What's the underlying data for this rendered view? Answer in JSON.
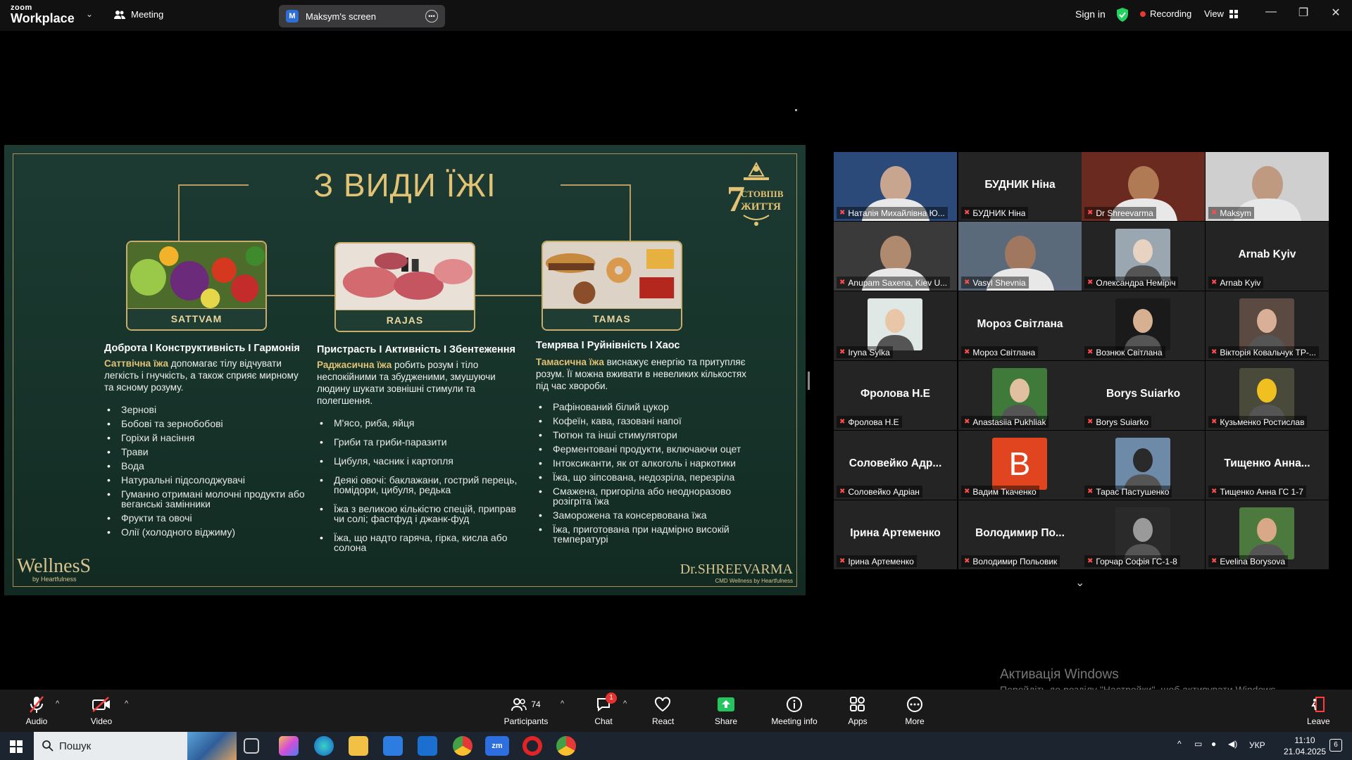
{
  "topbar": {
    "logo_top": "zoom",
    "logo_bottom": "Workplace",
    "meeting_label": "Meeting",
    "screen_avatar": "M",
    "screen_label": "Maksym's screen",
    "sign_in": "Sign in",
    "recording": "Recording",
    "view": "View"
  },
  "slide": {
    "title": "З ВИДИ ЇЖІ",
    "logo_line1": "СТОВПІВ",
    "logo_line2": "ЖИТТЯ",
    "logo_number": "7",
    "cards": [
      "SATTVAM",
      "RAJAS",
      "TAMAS"
    ],
    "columns": [
      {
        "heading": "Доброта I Конструктивність I Гармонія",
        "keyword": "Саттвічна їжа",
        "description": " допомагає тілу відчувати легкість і гнучкість, а також сприяє мирному та ясному розуму.",
        "items": [
          "Зернові",
          "Бобові та зернобобові",
          "Горіхи й насіння",
          "Трави",
          "Вода",
          "Натуральні підсолоджувачі",
          "Гуманно отримані молочні продукти або веганські замінники",
          "Фрукти та овочі",
          "Олії (холодного віджиму)"
        ]
      },
      {
        "heading": "Пристрасть I Активність I Збентеження",
        "keyword": "Раджасична їжа",
        "description": " робить розум і тіло неспокійними та збудженими, змушуючи людину шукати зовнішні стимули та полегшення.",
        "items": [
          "М'ясо, риба, яйця",
          "Гриби та гриби-паразити",
          "Цибуля, часник і картопля",
          "Деякі овочі: баклажани, гострий перець, помідори, цибуля, редька",
          "Їжа з великою кількістю спецій, приправ чи солі; фастфуд і джанк-фуд",
          "Їжа, що надто гаряча, гірка, кисла або солона"
        ]
      },
      {
        "heading": "Темрява I Руйнівність I Хаос",
        "keyword": "Тамасична їжа",
        "description": " виснажує енергію та притупляє розум. Її можна вживати в невеликих кількостях під час хвороби.",
        "items": [
          "Рафінований білий цукор",
          "Кофеїн, кава, газовані напої",
          "Тютюн та інші стимулятори",
          "Ферментовані продукти, включаючи оцет",
          "Інтоксиканти, як от алкоголь і наркотики",
          "Їжа, що зіпсована, недозріла, перезріла",
          "Смажена, пригоріла або неодноразово розігріта їжа",
          "Заморожена та консервована їжа",
          "Їжа, приготована при надмірно високій температурі"
        ]
      }
    ],
    "footer_left": "WellnesS",
    "footer_left_sub": "by Heartfulness",
    "footer_right": "Dr.SHREEVARMA",
    "footer_right_sub": "CMD Wellness by Heartfulness"
  },
  "participants": [
    {
      "name": "Наталія Михайлівна Ю...",
      "big": "",
      "video": "v1"
    },
    {
      "name": "БУДНИК Ніна",
      "big": "БУДНИК Ніна",
      "video": ""
    },
    {
      "name": "Dr Shreevarma",
      "big": "",
      "video": "v3"
    },
    {
      "name": "Maksym",
      "big": "",
      "video": "v4"
    },
    {
      "name": "Anupam Saxena, Kiev U...",
      "big": "",
      "video": "v5"
    },
    {
      "name": "Vasyl Shevnia",
      "big": "",
      "video": "v6"
    },
    {
      "name": "Олександра Неміріч",
      "big": "",
      "video": "a7"
    },
    {
      "name": "Arnab Kyiv",
      "big": "Arnab Kyiv",
      "video": ""
    },
    {
      "name": "Iryna Sylka",
      "big": "",
      "video": "a9"
    },
    {
      "name": "Мороз Світлана",
      "big": "Мороз Світлана",
      "video": ""
    },
    {
      "name": "Вознюк Світлана",
      "big": "",
      "video": "a11"
    },
    {
      "name": "Вікторія Ковальчук ТР-...",
      "big": "",
      "video": "a12"
    },
    {
      "name": "Фролова Н.Е",
      "big": "Фролова Н.Е",
      "video": ""
    },
    {
      "name": "Anastasiia Pukhliak",
      "big": "",
      "video": "a14"
    },
    {
      "name": "Borys Suiarko",
      "big": "Borys Suiarko",
      "video": ""
    },
    {
      "name": "Кузьменко Ростислав",
      "big": "",
      "video": "a16"
    },
    {
      "name": "Соловейко Адріан",
      "big": "Соловейко Адр...",
      "video": ""
    },
    {
      "name": "Вадим Ткаченко",
      "big": "",
      "video": "b18"
    },
    {
      "name": "Тарас Пастушенко",
      "big": "",
      "video": "a19"
    },
    {
      "name": "Тищенко Анна ГС 1-7",
      "big": "Тищенко Анна...",
      "video": ""
    },
    {
      "name": "Ірина Артеменко",
      "big": "Ірина Артеменко",
      "video": ""
    },
    {
      "name": "Володимир Польовик",
      "big": "Володимир По...",
      "video": ""
    },
    {
      "name": "Горчар Софія ГС-1-8",
      "big": "",
      "video": "a23"
    },
    {
      "name": "Evelina Borysova",
      "big": "",
      "video": "a24"
    }
  ],
  "vadym_letter": "B",
  "watermark": {
    "title": "Активація Windows",
    "text": "Перейдіть до розділу \"Настройки\", щоб активувати Windows."
  },
  "toolbar": {
    "audio": "Audio",
    "video": "Video",
    "participants": "Participants",
    "participants_count": "74",
    "chat": "Chat",
    "chat_badge": "1",
    "react": "React",
    "share": "Share",
    "meeting_info": "Meeting info",
    "apps": "Apps",
    "more": "More",
    "leave": "Leave"
  },
  "taskbar": {
    "search_placeholder": "Пошук",
    "lang": "УКР",
    "time": "11:10",
    "date": "21.04.2025",
    "notif": "6"
  },
  "colors": {
    "accent_green": "#23d160",
    "record_red": "#e53935",
    "slide_gold": "#e2c274",
    "share_green": "#23c55e"
  }
}
